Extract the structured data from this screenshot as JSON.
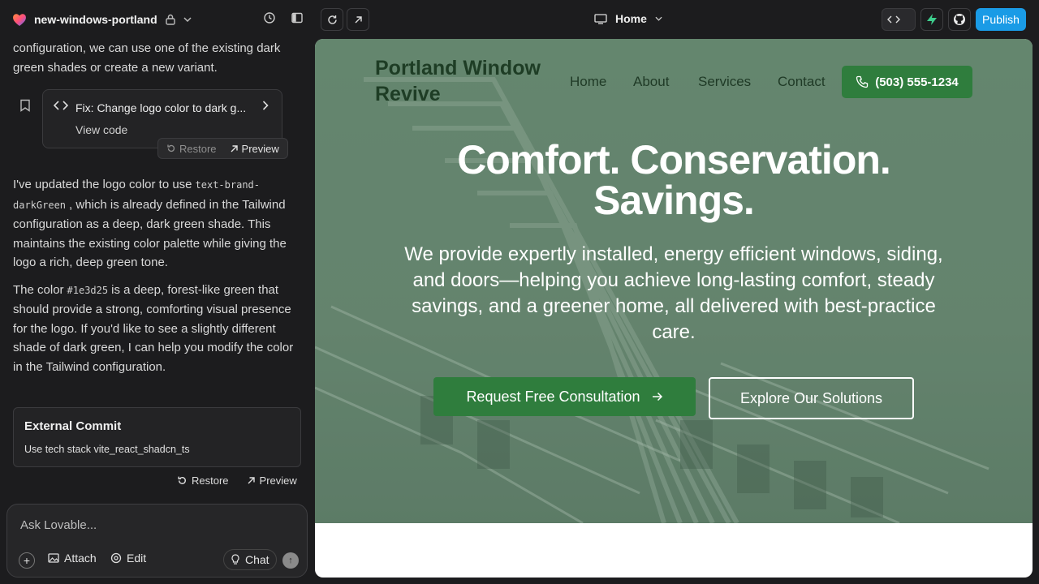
{
  "header": {
    "project_name": "new-windows-portland",
    "icons": [
      "heart-logo-icon",
      "lock-icon",
      "chevron-down-icon",
      "history-icon",
      "sidebar-toggle-icon"
    ]
  },
  "chat": {
    "intro_text": "configuration, we can use one of the existing dark green shades or create a new variant.",
    "fix_card": {
      "title": "Fix: Change logo color to dark g...",
      "view_code": "View code",
      "restore": "Restore",
      "preview": "Preview"
    },
    "msg1_a": "I've updated the logo color to use",
    "msg1_code": "text-brand-darkGreen",
    "msg1_b": ", which is already defined in the Tailwind configuration as a deep, dark green shade. This maintains the existing color palette while giving the logo a rich, deep green tone.",
    "msg2_a": "The color",
    "msg2_code": "#1e3d25",
    "msg2_b": "is a deep, forest-like green that should provide a strong, comforting visual presence for the logo. If you'd like to see a slightly different shade of dark green, I can help you modify the color in the Tailwind configuration.",
    "commit": {
      "title": "External Commit",
      "subtitle": "Use tech stack vite_react_shadcn_ts",
      "restore": "Restore",
      "preview": "Preview"
    }
  },
  "composer": {
    "placeholder": "Ask Lovable...",
    "attach": "Attach",
    "edit": "Edit",
    "chat": "Chat"
  },
  "toolbar": {
    "route": "Home",
    "publish": "Publish",
    "code_icon": "code-icon",
    "accent": "#1a9be6"
  },
  "site": {
    "brand": "Portland Window Revive",
    "brand_color": "#1e3d25",
    "nav": [
      "Home",
      "About",
      "Services",
      "Contact"
    ],
    "phone": "(503) 555-1234",
    "headline_1": "Comfort. Conservation.",
    "headline_2": "Savings.",
    "subheadline": "We provide expertly installed, energy efficient windows, siding, and doors—helping you achieve long-lasting comfort, steady savings, and a greener home, all delivered with best-practice care.",
    "cta_primary": "Request Free Consultation",
    "cta_secondary": "Explore Our Solutions",
    "accent_green": "#2f7d3d"
  }
}
